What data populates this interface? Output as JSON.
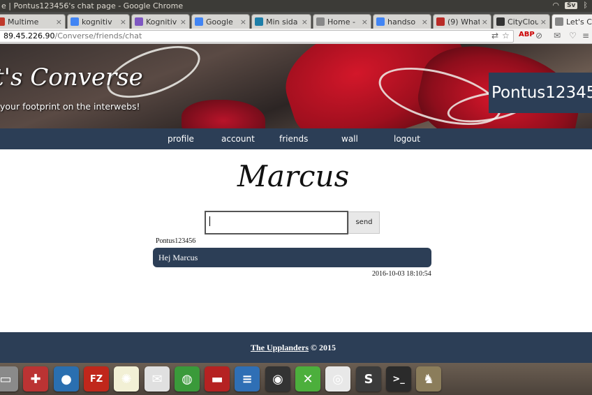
{
  "os": {
    "window_title": "e | Pontus123456's chat page - Google Chrome",
    "language_indicator": "Sv",
    "clock": "",
    "icons": [
      "wifi-icon",
      "bluetooth-icon",
      "battery-icon",
      "volume-icon",
      "mail-icon",
      "power-icon"
    ]
  },
  "tabs": [
    {
      "label": "Multime",
      "favicon_color": "#c0392b"
    },
    {
      "label": "kognitiv",
      "favicon_color": "#4285f4"
    },
    {
      "label": "Kognitiv",
      "favicon_color": "#7e57c2"
    },
    {
      "label": "Google",
      "favicon_color": "#4285f4"
    },
    {
      "label": "Min sida",
      "favicon_color": "#1e7ea8"
    },
    {
      "label": "Home -",
      "favicon_color": "#888888"
    },
    {
      "label": "handso",
      "favicon_color": "#4285f4"
    },
    {
      "label": "(9) What",
      "favicon_color": "#b92b27"
    },
    {
      "label": "CityClou",
      "favicon_color": "#333333"
    },
    {
      "label": "Let's Co",
      "favicon_color": "#888888"
    }
  ],
  "address_bar": {
    "host": "89.45.226.90",
    "path": "/Converse/friends/chat"
  },
  "banner": {
    "title": "t's Converse",
    "tagline": "your footprint on the interwebs!",
    "username": "Pontus123456"
  },
  "nav": {
    "items": [
      "profile",
      "account",
      "friends",
      "wall",
      "logout"
    ]
  },
  "chat": {
    "friend_name": "Marcus",
    "input_value": "",
    "send_label": "send",
    "messages": [
      {
        "author": "Pontus123456",
        "text": "Hej Marcus",
        "timestamp": "2016-10-03 18:10:54"
      }
    ]
  },
  "footer": {
    "link": "The Upplanders",
    "suffix": " © 2015"
  },
  "dock": {
    "apps": [
      {
        "name": "files-icon",
        "color": "#8a8a8a",
        "glyph": "▭"
      },
      {
        "name": "settings-icon",
        "color": "#b33",
        "glyph": "✚"
      },
      {
        "name": "droplet-icon",
        "color": "#2a6fb0",
        "glyph": "●"
      },
      {
        "name": "filezilla-icon",
        "color": "#c0271b",
        "glyph": "FZ"
      },
      {
        "name": "sun-icon",
        "color": "#f2f0d5",
        "glyph": "✺"
      },
      {
        "name": "mail-app-icon",
        "color": "#e0e0e0",
        "glyph": "✉"
      },
      {
        "name": "globe-icon",
        "color": "#3a9a3a",
        "glyph": "◍"
      },
      {
        "name": "book-icon",
        "color": "#b52222",
        "glyph": "▬"
      },
      {
        "name": "writer-icon",
        "color": "#2f6fb5",
        "glyph": "≡"
      },
      {
        "name": "steam-icon",
        "color": "#333",
        "glyph": "◉"
      },
      {
        "name": "xmind-icon",
        "color": "#4caf3c",
        "glyph": "✕"
      },
      {
        "name": "chrome-icon",
        "color": "#e8e8e8",
        "glyph": "◎"
      },
      {
        "name": "sublime-icon",
        "color": "#3b3b3b",
        "glyph": "S"
      },
      {
        "name": "terminal-icon",
        "color": "#2b2b2b",
        "glyph": ">_"
      },
      {
        "name": "gimp-icon",
        "color": "#8b7d5b",
        "glyph": "♞"
      }
    ]
  }
}
